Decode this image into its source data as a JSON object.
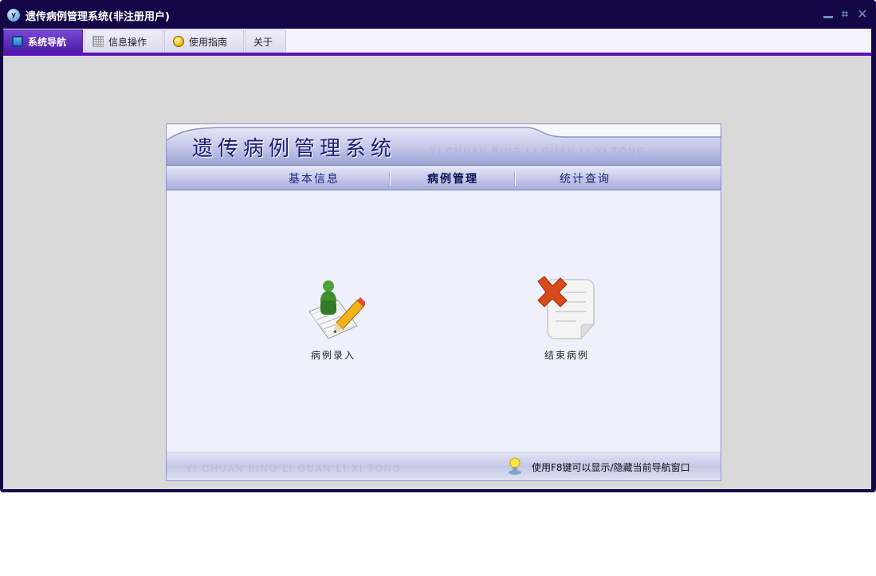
{
  "window": {
    "title": "遗传病例管理系统(非注册用户)"
  },
  "tabs": [
    {
      "label": "系统导航",
      "icon": "monitor-icon",
      "active": true
    },
    {
      "label": "信息操作",
      "icon": "grid-icon",
      "active": false
    },
    {
      "label": "使用指南",
      "icon": "help-icon",
      "active": false
    },
    {
      "label": "关于",
      "icon": "",
      "active": false
    }
  ],
  "panel": {
    "title": "遗传病例管理系统",
    "pinyin": "YI CHUAN BING LI GUAN LI XI TONG",
    "nav": [
      {
        "label": "基本信息",
        "active": false
      },
      {
        "label": "病例管理",
        "active": true
      },
      {
        "label": "统计查询",
        "active": false
      }
    ],
    "actions": [
      {
        "label": "病例录入",
        "icon": "case-entry-icon"
      },
      {
        "label": "结束病例",
        "icon": "end-case-icon"
      }
    ],
    "footer_pinyin": "YI CHUAN BING LI GUAN LI XI TONG",
    "footer_tip": "使用F8键可以显示/隐藏当前导航窗口"
  },
  "colors": {
    "window_frame": "#140747",
    "tab_active": "#5a1cb8",
    "content_bg": "#d9d9d9",
    "panel_title": "#1a1d78"
  }
}
